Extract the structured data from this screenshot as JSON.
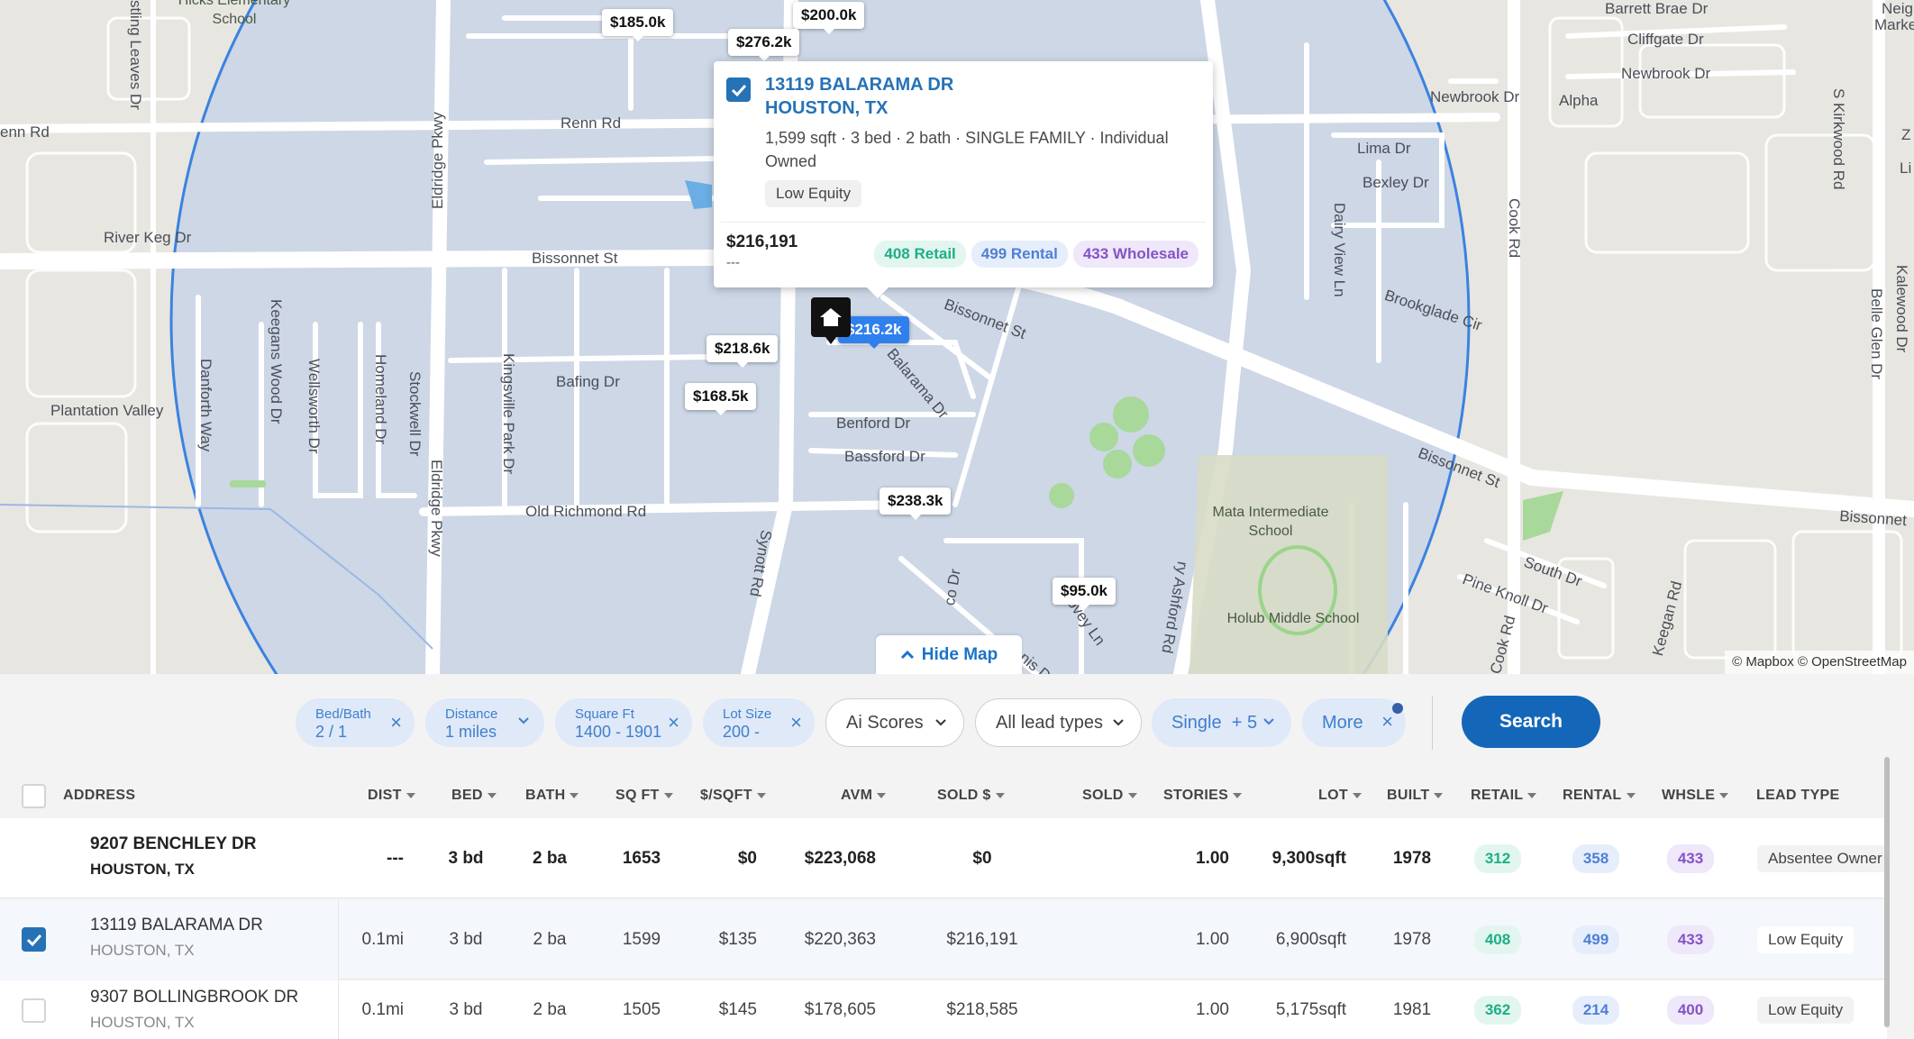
{
  "map": {
    "street_labels": {
      "renn_rd": "Renn Rd",
      "renn_rd_left": "enn Rd",
      "river_keg": "River Keg Dr",
      "bissonnet_1": "Bissonnet St",
      "bissonnet_2": "Bissonnet St",
      "bissonnet_3": "Bissonnet St",
      "bissonnet_4": "Bissonnet",
      "plantation": "Plantation Valley",
      "old_richmond": "Old Richmond Rd",
      "bafing": "Bafing Dr",
      "benford": "Benford Dr",
      "bassford": "Bassford Dr",
      "balarama": "Balarama Dr",
      "eldridge_1": "Eldridge Pkwy",
      "eldridge_2": "Eldridge Pkwy",
      "synott": "Synott Rd",
      "ashford": "ry Ashford Rd",
      "danforth": "Danforth Way",
      "keegans_wood": "Keegans Wood Dr",
      "wellsworth": "Wellsworth Dr",
      "homeland": "Homeland Dr",
      "stockwell": "Stockwell Dr",
      "kingsville": "Kingsville Park Dr",
      "sling_leaves": "stling Leaves Dr",
      "newbrook_1": "Newbrook Dr",
      "newbrook_2": "Newbrook Dr",
      "cliffgate": "Cliffgate Dr",
      "barrett_brae": "Barrett Brae Dr",
      "alpha": "Alpha",
      "lima": "Lima Dr",
      "bexley": "Bexley Dr",
      "dairy_view": "Dairy View Ln",
      "brookglade": "Brookglade Cir",
      "cook_rd_1": "Cook Rd",
      "cook_rd_2": "Cook Rd",
      "south_dr": "South Dr",
      "pine_knoll": "Pine Knoll Dr",
      "keegan_rd": "Keegan Rd",
      "kirkwood": "S Kirkwood Rd",
      "belle_glen": "Belle Glen Dr",
      "kalewood": "Kalewood Dr",
      "neighbor": "Neighbo",
      "marke": "Marke",
      "z_cut": "Z",
      "li_cut": "Li",
      "ovey": "ovey Ln",
      "co_dr": "co Dr",
      "innis": "nis D"
    },
    "schools": {
      "hicks": "Hicks Elementary School",
      "mata": "Mata Intermediate School",
      "holub": "Holub Middle School"
    },
    "price_pins": [
      "$185.0k",
      "$200.0k",
      "$276.2k",
      "$218.6k",
      "$168.5k",
      "$238.3k",
      "$95.0k",
      "$216.2k"
    ],
    "attribution": "© Mapbox © OpenStreetMap",
    "hide_map_label": "Hide Map"
  },
  "popup": {
    "address_line1": "13119 BALARAMA DR",
    "address_line2": "HOUSTON, TX",
    "description": "1,599 sqft · 3 bed · 2 bath · SINGLE FAMILY · Individual Owned",
    "tag": "Low Equity",
    "price": "$216,191",
    "secondary": "---",
    "retail": "408 Retail",
    "rental": "499 Rental",
    "wholesale": "433 Wholesale"
  },
  "filters": {
    "bed_bath": {
      "label": "Bed/Bath",
      "value": "2 / 1"
    },
    "distance": {
      "label": "Distance",
      "value": "1 miles"
    },
    "square_ft": {
      "label": "Square Ft",
      "value": "1400 - 1901"
    },
    "lot_size": {
      "label": "Lot Size",
      "value": "200 -"
    },
    "ai_scores": "Ai Scores",
    "lead_types": "All lead types",
    "property_type": "Single  + 5",
    "more": "More",
    "search": "Search"
  },
  "table": {
    "columns": [
      "ADDRESS",
      "DIST",
      "BED",
      "BATH",
      "SQ FT",
      "$/SQFT",
      "AVM",
      "SOLD $",
      "SOLD",
      "STORIES",
      "LOT",
      "BUILT",
      "RETAIL",
      "RENTAL",
      "WHSLE",
      "LEAD TYPE"
    ],
    "rows": [
      {
        "addr1": "9207 BENCHLEY DR",
        "addr2": "HOUSTON, TX",
        "dist": "---",
        "bed": "3 bd",
        "bath": "2 ba",
        "sqft": "1653",
        "ppsf": "$0",
        "avm": "$223,068",
        "sold_price": "$0",
        "sold": "",
        "stories": "1.00",
        "lot": "9,300sqft",
        "built": "1978",
        "retail": "312",
        "rental": "358",
        "whsle": "433",
        "lead": "Absentee Owner",
        "checked": false
      },
      {
        "addr1": "13119 BALARAMA DR",
        "addr2": "HOUSTON, TX",
        "dist": "0.1mi",
        "bed": "3 bd",
        "bath": "2 ba",
        "sqft": "1599",
        "ppsf": "$135",
        "avm": "$220,363",
        "sold_price": "$216,191",
        "sold": "",
        "stories": "1.00",
        "lot": "6,900sqft",
        "built": "1978",
        "retail": "408",
        "rental": "499",
        "whsle": "433",
        "lead": "Low Equity",
        "checked": true
      },
      {
        "addr1": "9307 BOLLINGBROOK DR",
        "addr2": "HOUSTON, TX",
        "dist": "0.1mi",
        "bed": "3 bd",
        "bath": "2 ba",
        "sqft": "1505",
        "ppsf": "$145",
        "avm": "$178,605",
        "sold_price": "$218,585",
        "sold": "",
        "stories": "1.00",
        "lot": "5,175sqft",
        "built": "1981",
        "retail": "362",
        "rental": "214",
        "whsle": "400",
        "lead": "Low Equity",
        "checked": false
      }
    ]
  },
  "colors": {
    "accent": "#2672b6",
    "search_button": "#1467b8",
    "radius_overlay": "#c8d3e6",
    "retail": "#1fae86",
    "rental": "#4f7fd6",
    "wholesale": "#8454c6"
  }
}
